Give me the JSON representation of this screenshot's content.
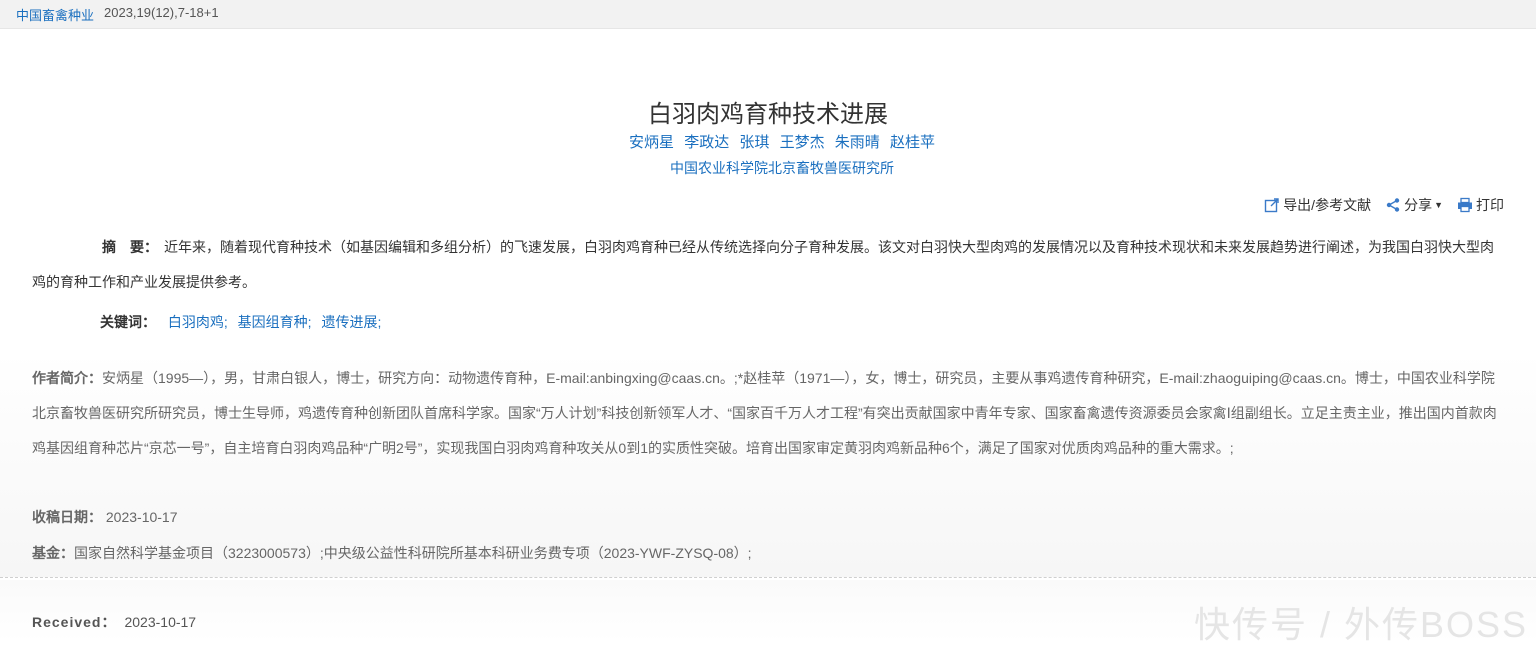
{
  "header": {
    "journal": "中国畜禽种业",
    "issue": "2023,19(12),7-18+1"
  },
  "article": {
    "title": "白羽肉鸡育种技术进展",
    "authors": [
      "安炳星",
      "李政达",
      "张琪",
      "王梦杰",
      "朱雨晴",
      "赵桂苹"
    ],
    "affiliation": "中国农业科学院北京畜牧兽医研究所"
  },
  "tools": {
    "export": "导出/参考文献",
    "share": "分享",
    "print": "打印"
  },
  "abstract": {
    "label": "摘　要：",
    "text": "近年来，随着现代育种技术（如基因编辑和多组分析）的飞速发展，白羽肉鸡育种已经从传统选择向分子育种发展。该文对白羽快大型肉鸡的发展情况以及育种技术现状和未来发展趋势进行阐述，为我国白羽快大型肉鸡的育种工作和产业发展提供参考。"
  },
  "keywords": {
    "label": "关键词：",
    "items": [
      "白羽肉鸡;",
      "基因组育种;",
      "遗传进展;"
    ]
  },
  "author_intro": {
    "label": "作者简介：",
    "text": "安炳星（1995—），男，甘肃白银人，博士，研究方向：动物遗传育种，E-mail:anbingxing@caas.cn。;*赵桂苹（1971—），女，博士，研究员，主要从事鸡遗传育种研究，E-mail:zhaoguiping@caas.cn。博士，中国农业科学院北京畜牧兽医研究所研究员，博士生导师，鸡遗传育种创新团队首席科学家。国家“万人计划”科技创新领军人才、“国家百千万人才工程”有突出贡献国家中青年专家、国家畜禽遗传资源委员会家禽Ⅰ组副组长。立足主责主业，推出国内首款肉鸡基因组育种芯片“京芯一号”，自主培育白羽肉鸡品种“广明2号”，实现我国白羽肉鸡育种攻关从0到1的实质性突破。培育出国家审定黄羽肉鸡新品种6个，满足了国家对优质肉鸡品种的重大需求。;"
  },
  "received_date": {
    "label": "收稿日期：",
    "value": "2023-10-17"
  },
  "fund": {
    "label": "基金：",
    "value": "国家自然科学基金项目（3223000573）;中央级公益性科研院所基本科研业务费专项（2023-YWF-ZYSQ-08）;"
  },
  "received_en": {
    "label": "Received：",
    "value": "2023-10-17"
  },
  "watermark": "快传号 / 外传BOSS"
}
